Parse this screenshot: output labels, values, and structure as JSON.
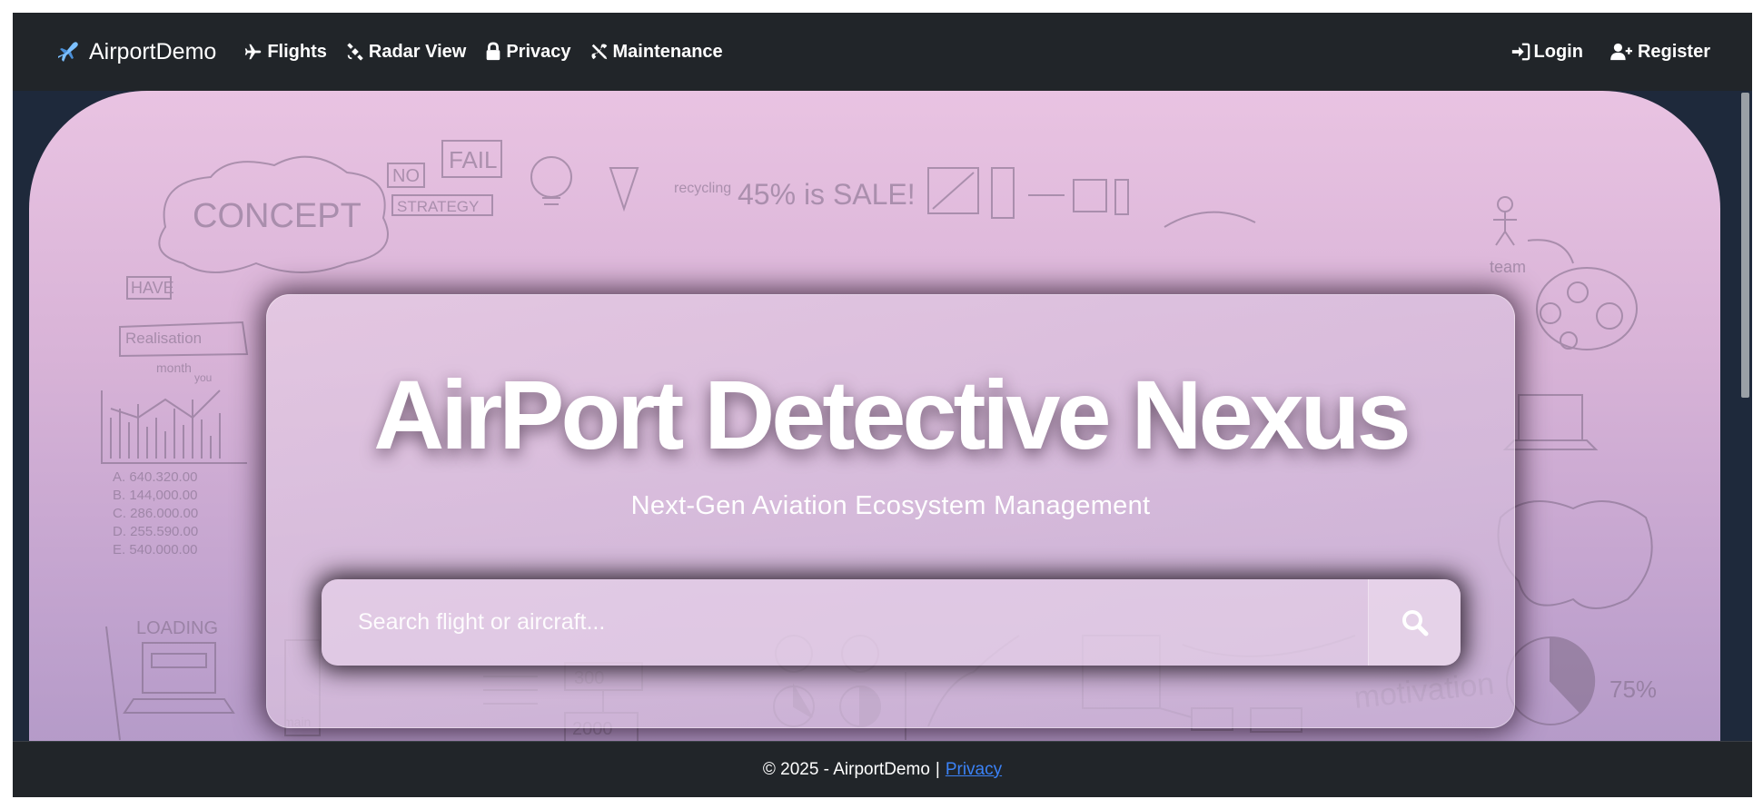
{
  "navbar": {
    "brand": "AirportDemo",
    "links": [
      {
        "label": "Flights",
        "icon": "plane-icon"
      },
      {
        "label": "Radar View",
        "icon": "satellite-icon"
      },
      {
        "label": "Privacy",
        "icon": "lock-icon"
      },
      {
        "label": "Maintenance",
        "icon": "tools-icon"
      }
    ],
    "right": [
      {
        "label": "Login",
        "icon": "sign-in-icon"
      },
      {
        "label": "Register",
        "icon": "user-plus-icon"
      }
    ]
  },
  "hero": {
    "title": "AirPort Detective Nexus",
    "subtitle": "Next-Gen Aviation Ecosystem Management",
    "search": {
      "placeholder": "Search flight or aircraft...",
      "button_icon": "search-icon"
    },
    "background_sketch_text": {
      "concept": "CONCEPT",
      "no": "NO",
      "fail": "FAIL",
      "strategy": "STRATEGY",
      "recycling": "recycling",
      "sale": "45% is SALE!",
      "have": "HAVE",
      "realisation": "Realisation",
      "month": "month",
      "you": "you",
      "a_val": "A. 640.320.00",
      "b_val": "B. 144,000.00",
      "c_val": "C. 286.000.00",
      "d_val": "D. 255.590.00",
      "e_val": "E. 540.000.00",
      "loading": "LOADING",
      "main": "main",
      "v300": "300",
      "v2000": "2000",
      "team": "team",
      "motivation": "motivation",
      "pct75": "75%"
    }
  },
  "footer": {
    "copyright": "© 2025 - AirportDemo",
    "separator": "|",
    "privacy_link": "Privacy"
  },
  "colors": {
    "navbar_bg": "#212529",
    "page_dark": "#1e293b",
    "link": "#3b82f6",
    "hero_top": "#e9c3e2",
    "hero_bottom": "#b49ac8"
  }
}
